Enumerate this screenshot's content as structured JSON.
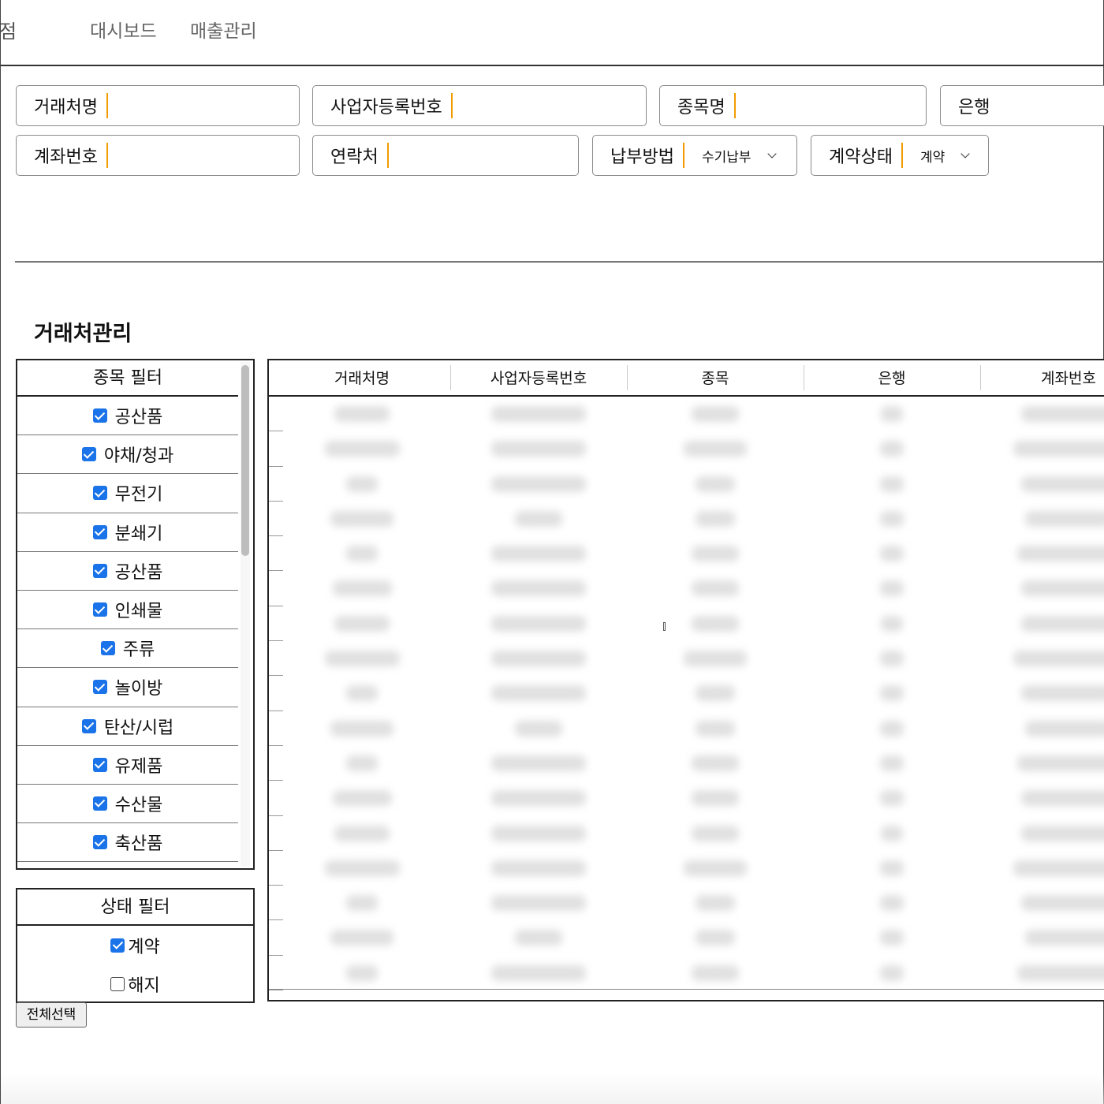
{
  "header": {
    "brand": "점",
    "nav": [
      "대시보드",
      "매출관리"
    ]
  },
  "search": {
    "fields": [
      {
        "label": "거래처명",
        "value": ""
      },
      {
        "label": "사업자등록번호",
        "value": ""
      },
      {
        "label": "종목명",
        "value": ""
      },
      {
        "label": "은행",
        "value": ""
      },
      {
        "label": "계좌번호",
        "value": ""
      },
      {
        "label": "연락처",
        "value": ""
      }
    ],
    "payment": {
      "label": "납부방법",
      "selected": "수기납부"
    },
    "contract": {
      "label": "계약상태",
      "selected": "계약"
    }
  },
  "section_title": "거래처관리",
  "category_filter": {
    "title": "종목 필터",
    "items": [
      {
        "label": "공산품",
        "checked": true
      },
      {
        "label": "야채/청과",
        "checked": true
      },
      {
        "label": "무전기",
        "checked": true
      },
      {
        "label": "분쇄기",
        "checked": true
      },
      {
        "label": "공산품",
        "checked": true
      },
      {
        "label": "인쇄물",
        "checked": true
      },
      {
        "label": "주류",
        "checked": true
      },
      {
        "label": "놀이방",
        "checked": true
      },
      {
        "label": "탄산/시럽",
        "checked": true
      },
      {
        "label": "유제품",
        "checked": true
      },
      {
        "label": "수산물",
        "checked": true
      },
      {
        "label": "축산품",
        "checked": true
      }
    ]
  },
  "status_filter": {
    "title": "상태 필터",
    "items": [
      {
        "label": "계약",
        "checked": true
      },
      {
        "label": "해지",
        "checked": false
      }
    ]
  },
  "select_all_label": "전체선택",
  "table": {
    "columns": [
      "거래처명",
      "사업자등록번호",
      "종목",
      "은행",
      "계좌번호"
    ],
    "row_count": 17
  },
  "colors": {
    "accent_separator": "#f29b00",
    "checkbox": "#1a73e8"
  }
}
